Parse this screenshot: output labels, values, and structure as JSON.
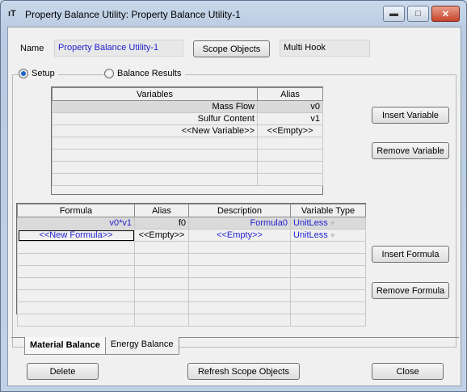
{
  "window": {
    "title": "Property Balance Utility: Property Balance Utility-1",
    "app_icon": "ıT",
    "controls": [
      "minimize-icon",
      "maximize-icon",
      "close-icon"
    ]
  },
  "header": {
    "name_label": "Name",
    "name_value": "Property Balance Utility-1",
    "scope_objects_label": "Scope Objects",
    "hook_value": "Multi Hook"
  },
  "radios": {
    "setup_label": "Setup",
    "balance_results_label": "Balance Results",
    "selected": "Setup"
  },
  "variables_table": {
    "headers": [
      "Variables",
      "Alias"
    ],
    "rows": [
      {
        "variable": "Mass Flow",
        "alias": "v0"
      },
      {
        "variable": "Sulfur Content",
        "alias": "v1"
      },
      {
        "variable": "<<New Variable>>",
        "alias": "<<Empty>>"
      }
    ]
  },
  "variable_buttons": {
    "insert": "Insert Variable",
    "remove": "Remove Variable"
  },
  "formula_table": {
    "headers": [
      "Formula",
      "Alias",
      "Description",
      "Variable Type"
    ],
    "rows": [
      {
        "formula": "v0*v1",
        "alias": "f0",
        "description": "Formula0",
        "type": "UnitLess"
      },
      {
        "formula": "<<New Formula>>",
        "alias": "<<Empty>>",
        "description": "<<Empty>>",
        "type": "UnitLess"
      }
    ]
  },
  "formula_buttons": {
    "insert": "Insert Formula",
    "remove": "Remove Formula"
  },
  "tabs": [
    "Material Balance",
    "Energy Balance"
  ],
  "active_tab": "Material Balance",
  "footer": {
    "delete": "Delete",
    "refresh": "Refresh Scope Objects",
    "close": "Close"
  },
  "colors": {
    "link_blue": "#1f1fcf",
    "close_red": "#c7432a",
    "radio_blue": "#1f64c8"
  }
}
